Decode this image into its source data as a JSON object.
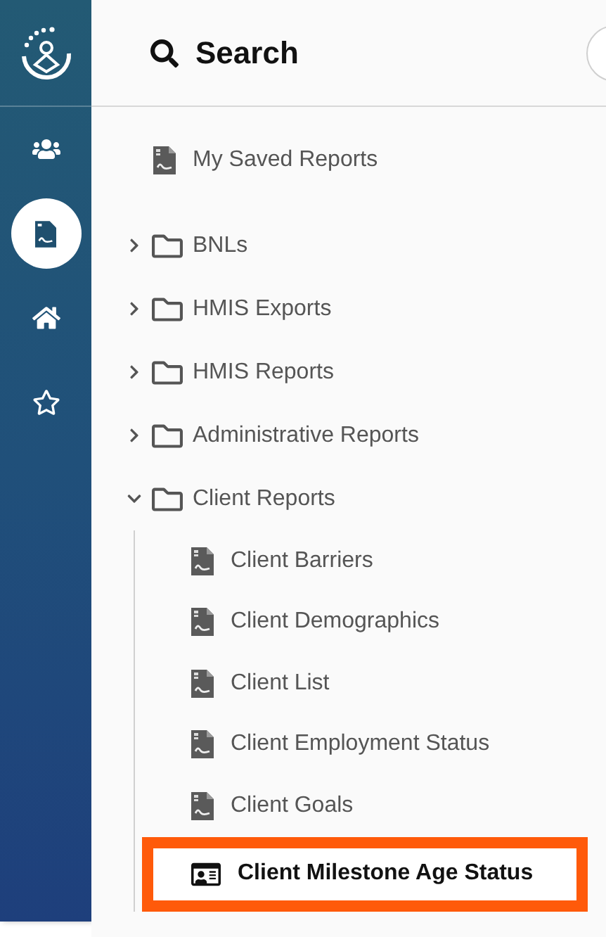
{
  "sidebar": {
    "nav": [
      {
        "kind": "users",
        "selected": false
      },
      {
        "kind": "report",
        "selected": true
      },
      {
        "kind": "home",
        "selected": false
      },
      {
        "kind": "star",
        "selected": false
      }
    ]
  },
  "header": {
    "title": "Search"
  },
  "saved": {
    "label": "My Saved Reports"
  },
  "folders": [
    {
      "label": "BNLs",
      "expanded": false
    },
    {
      "label": "HMIS Exports",
      "expanded": false
    },
    {
      "label": "HMIS Reports",
      "expanded": false
    },
    {
      "label": "Administrative Reports",
      "expanded": false
    },
    {
      "label": "Client Reports",
      "expanded": true,
      "children": [
        {
          "label": "Client Barriers",
          "kind": "report",
          "selected": false,
          "highlighted": false
        },
        {
          "label": "Client Demographics",
          "kind": "report",
          "selected": false,
          "highlighted": false
        },
        {
          "label": "Client List",
          "kind": "report",
          "selected": false,
          "highlighted": false
        },
        {
          "label": "Client Employment Status",
          "kind": "report",
          "selected": false,
          "highlighted": false
        },
        {
          "label": "Client Goals",
          "kind": "report",
          "selected": false,
          "highlighted": false
        },
        {
          "label": "Client Milestone Age Status",
          "kind": "card",
          "selected": true,
          "highlighted": true
        }
      ]
    }
  ]
}
